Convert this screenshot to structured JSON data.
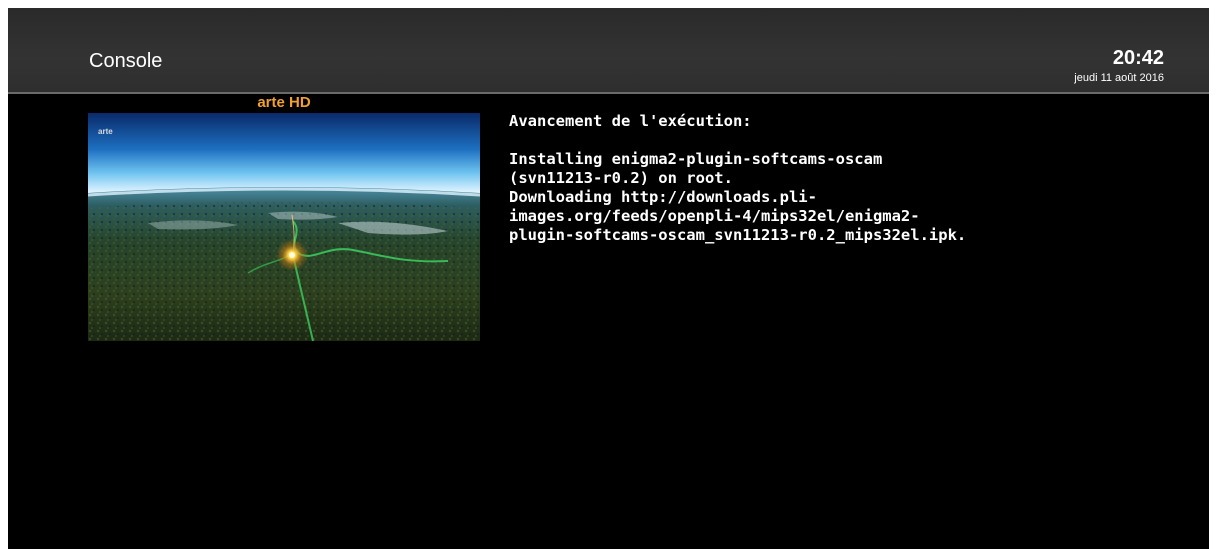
{
  "header": {
    "title": "Console",
    "time": "20:42",
    "date": "jeudi 11 août 2016"
  },
  "preview": {
    "channel_name": "arte HD",
    "logo_text": "arte",
    "channel_color": "#f0a030"
  },
  "console": {
    "heading": "Avancement de l'exécution:",
    "lines": [
      "Installing enigma2-plugin-softcams-oscam",
      "(svn11213-r0.2) on root.",
      "Downloading http://downloads.pli-",
      "images.org/feeds/openpli-4/mips32el/enigma2-",
      "plugin-softcams-oscam_svn11213-r0.2_mips32el.ipk."
    ]
  }
}
